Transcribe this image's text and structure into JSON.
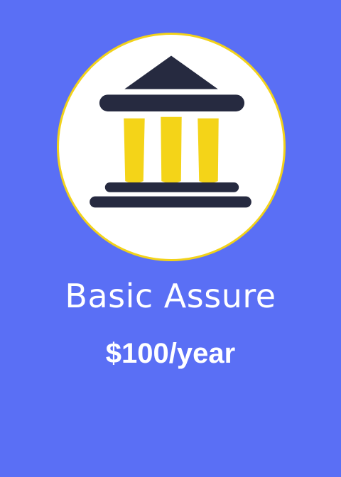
{
  "plan": {
    "name": "Basic Assure",
    "price": "$100/year",
    "icon": "bank-building-icon"
  },
  "colors": {
    "background": "#5a6ff5",
    "icon_circle": "#ffffff",
    "icon_ring": "#f2d21a",
    "icon_dark": "#262a40",
    "icon_columns": "#f4d418",
    "text": "#ffffff"
  }
}
